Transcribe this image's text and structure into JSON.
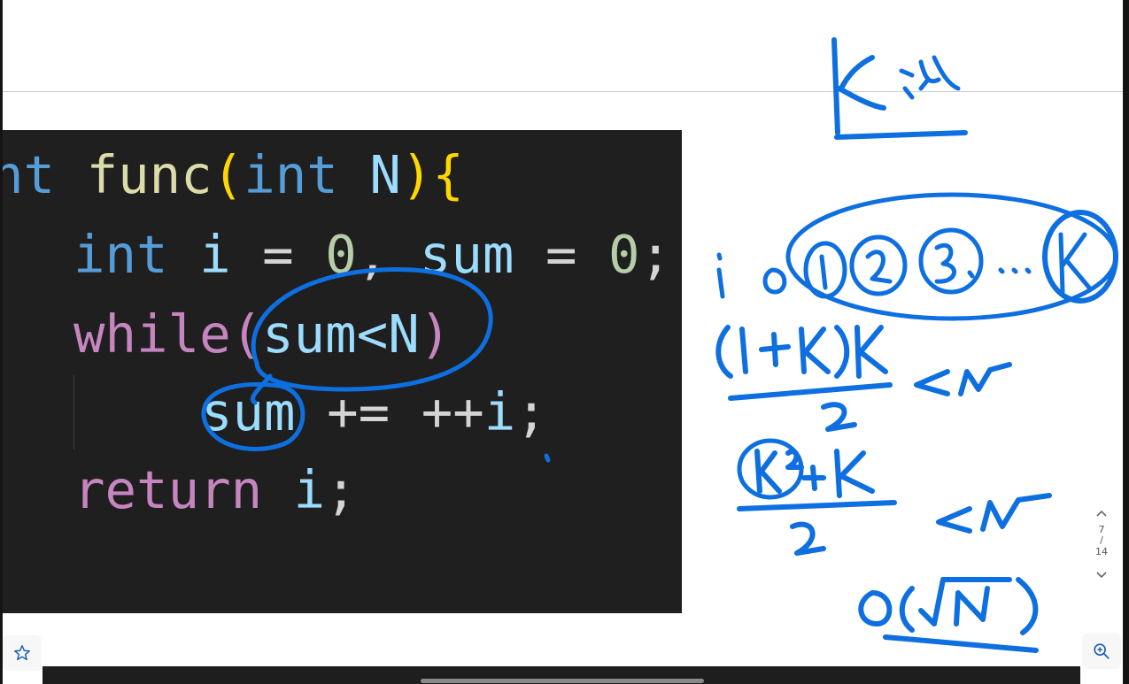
{
  "code": {
    "line1": {
      "kw_tail": "nt",
      "fn": "func",
      "open_paren": "(",
      "kw": "int",
      "param": "N",
      "close_paren": ")",
      "brace": "{"
    },
    "line2": {
      "kw": "int",
      "var1": "i",
      "eq1": "=",
      "zero1": "0",
      "comma": ",",
      "var2": "sum",
      "eq2": "=",
      "zero2": "0",
      "semi": ";"
    },
    "line3": {
      "kw": "while",
      "open_paren": "(",
      "cond": "sum<N",
      "close_paren": ")"
    },
    "line4": {
      "var": "sum",
      "op": "+=",
      "incr": "++",
      "var2": "i",
      "semi": ";"
    },
    "line5": {
      "kw": "return",
      "var": "i",
      "semi": ";"
    }
  },
  "navigation": {
    "current_page": "7",
    "separator": "/",
    "total_pages": "14",
    "up_icon": "chevron-up-icon",
    "down_icon": "chevron-down-icon"
  },
  "toolbar": {
    "star_icon": "star-icon",
    "zoom_icon": "zoom-in-icon"
  },
  "colors": {
    "ink": "#0e6fe0",
    "code_bg": "#1f1f1f",
    "keyword": "#569cd6",
    "function": "#dcdcaa",
    "control": "#c586c0",
    "identifier": "#9cdcfe",
    "number": "#b5cea8"
  }
}
